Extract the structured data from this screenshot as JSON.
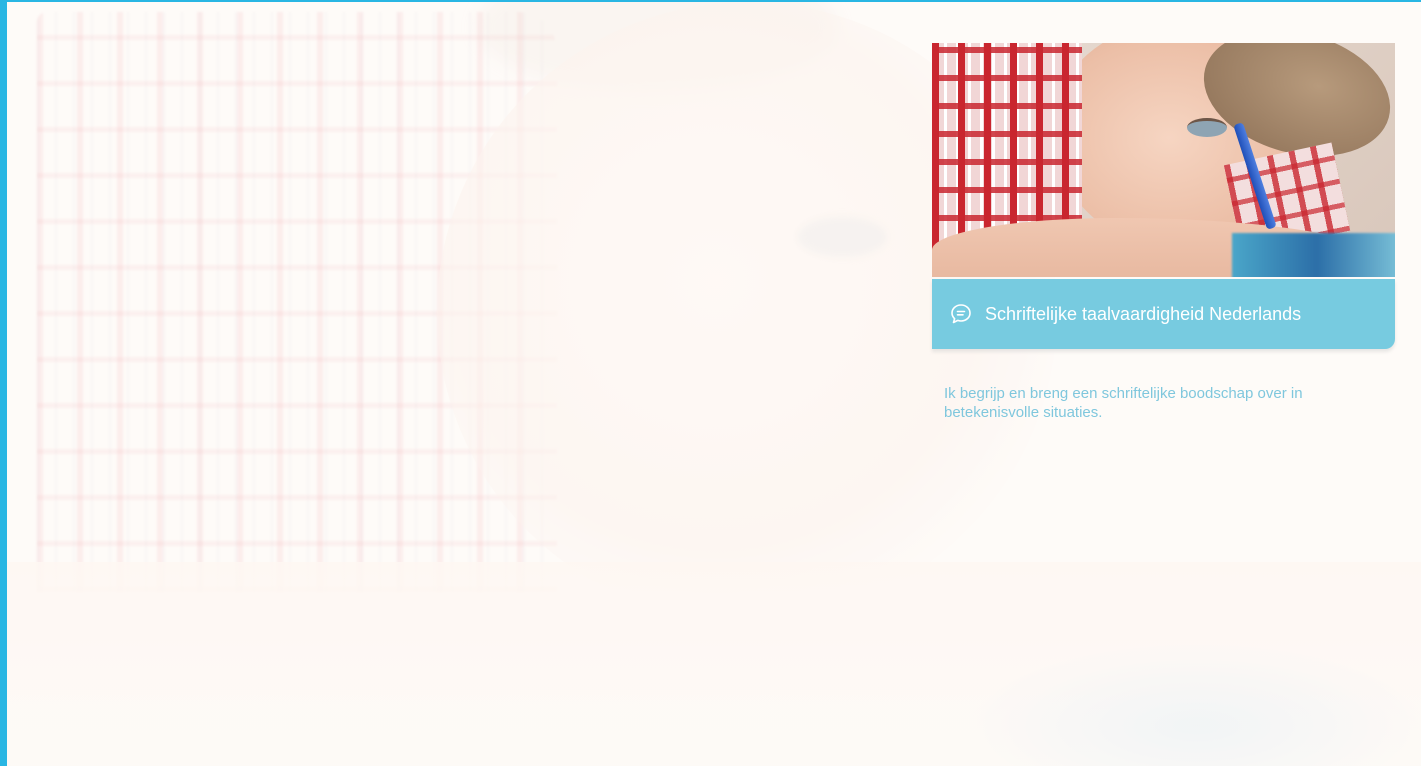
{
  "colors": {
    "frame_border": "#29b6e3",
    "card_bar": "#77cbe0",
    "description_text": "#7fc7dd",
    "title_text": "#ffffff"
  },
  "card": {
    "icon": "speech-bubble-icon",
    "title": "Schriftelijke taalvaardigheid Nederlands",
    "description": "Ik begrijp en breng een schriftelijke boodschap over in betekenisvolle situaties."
  }
}
